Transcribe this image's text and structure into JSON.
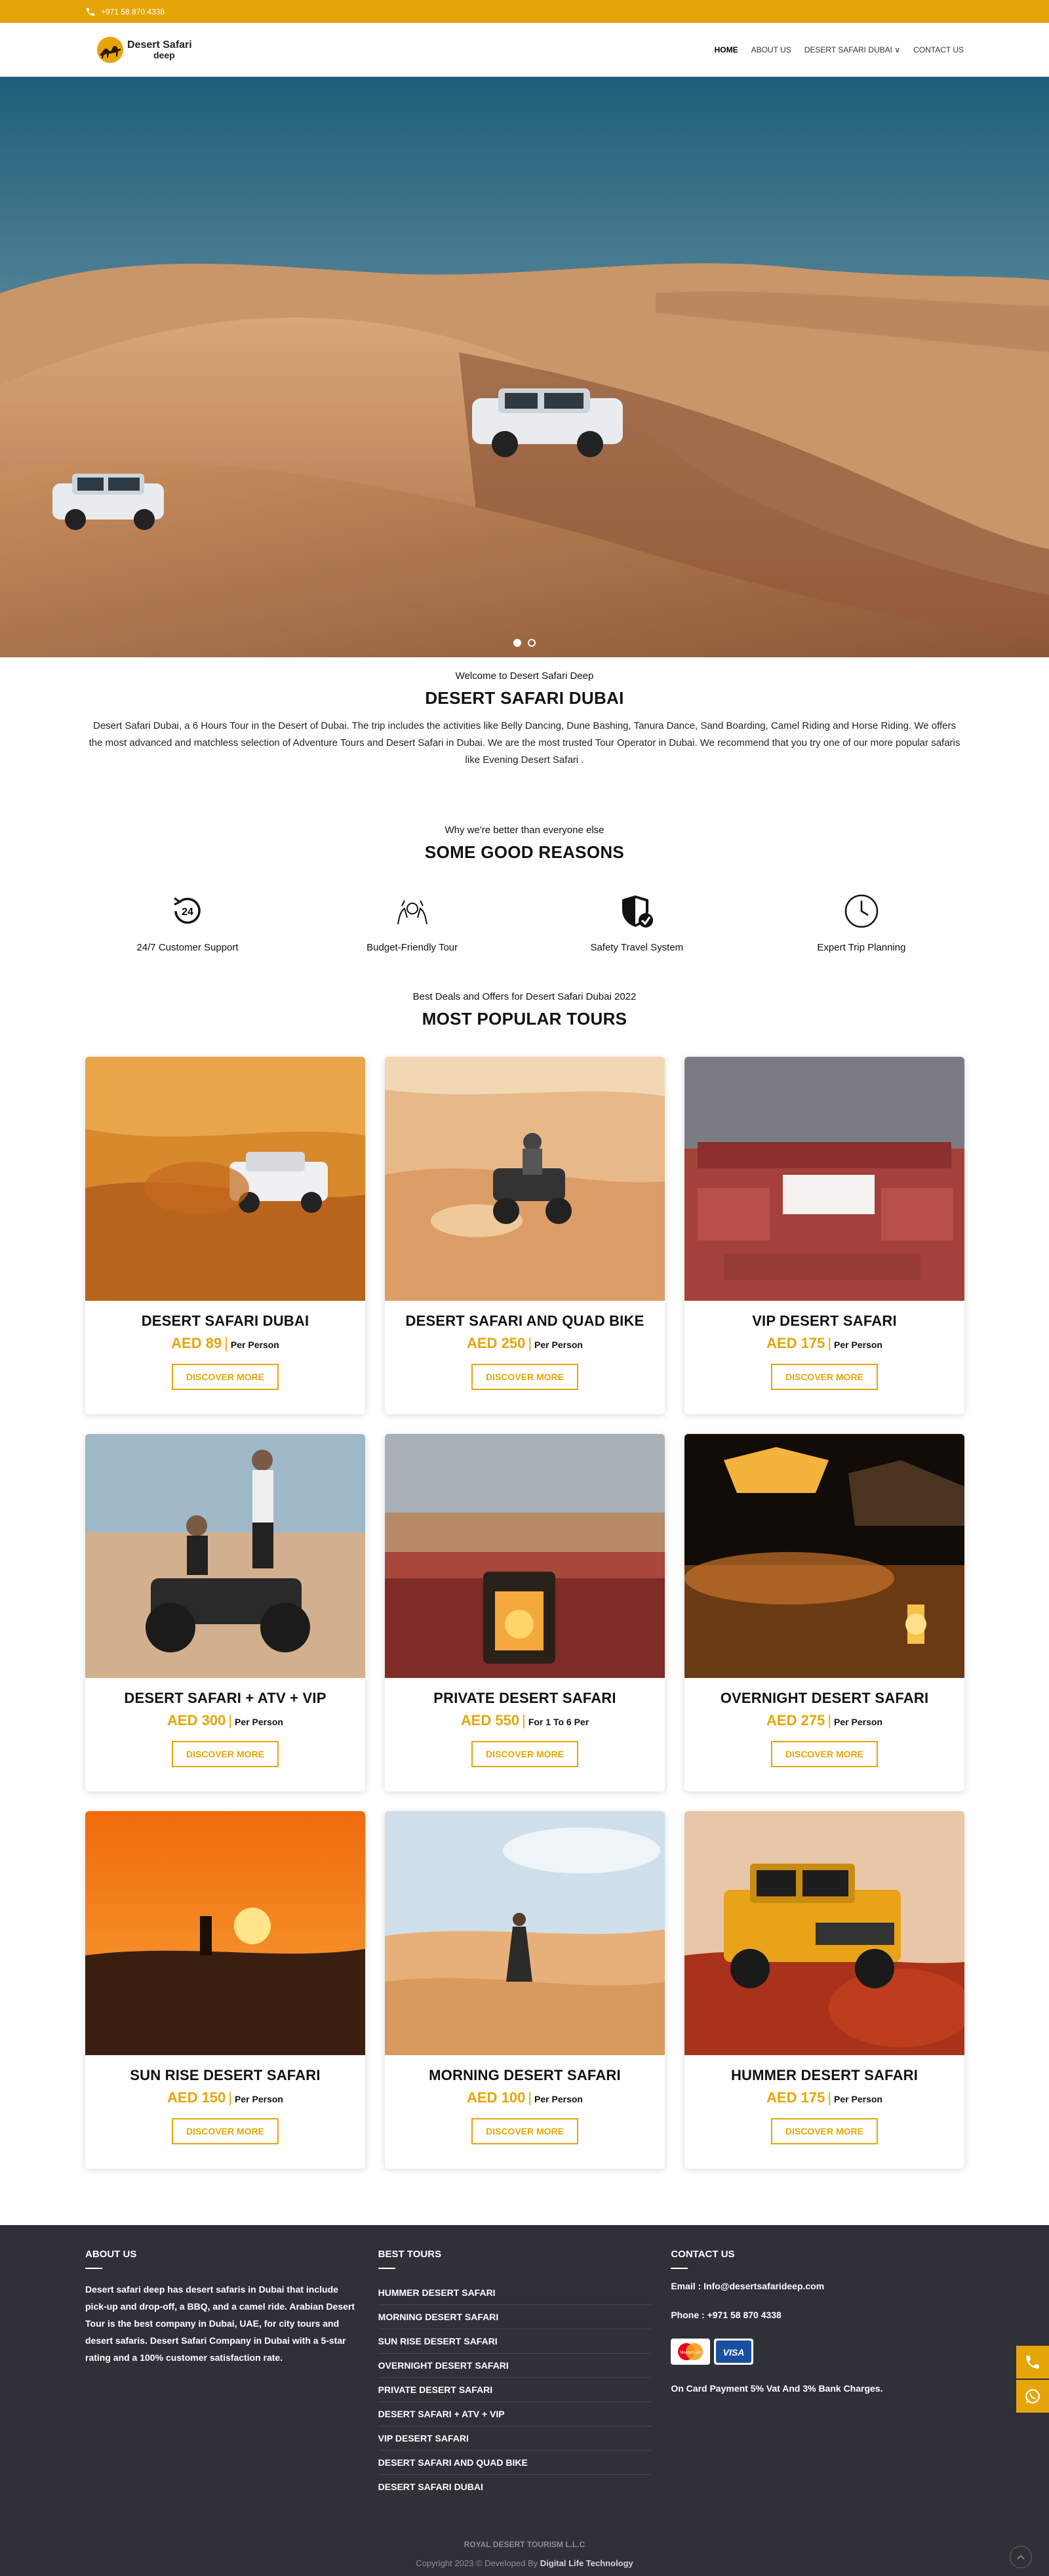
{
  "topbar": {
    "phone": "+971 58 870 4338",
    "icon": "phone-icon"
  },
  "header": {
    "logo_line1": "Desert Safari",
    "logo_line2": "deep",
    "nav": [
      {
        "label": "HOME",
        "active": true
      },
      {
        "label": "ABOUT US",
        "active": false
      },
      {
        "label": "DESERT SAFARI DUBAI ∨",
        "active": false
      },
      {
        "label": "CONTACT US",
        "active": false
      }
    ]
  },
  "hero": {
    "slides": 2,
    "active_slide": 1
  },
  "welcome": {
    "eyebrow": "Welcome to Desert Safari Deep",
    "title": "DESERT SAFARI DUBAI",
    "text": "Desert Safari Dubai, a 6 Hours Tour in the Desert of Dubai. The trip includes the activities like Belly Dancing, Dune Bashing, Tanura Dance, Sand Boarding, Camel Riding and Horse Riding. We offers the most advanced and matchless selection of Adventure Tours and Desert Safari in Dubai. We are the most trusted Tour Operator in Dubai. We recommend that you try one of our more popular safaris like Evening Desert Safari ."
  },
  "reasons": {
    "eyebrow": "Why we're better than everyone else",
    "title": "SOME GOOD REASONS",
    "items": [
      {
        "label": "24/7 Customer Support",
        "icon": "support-24-icon",
        "icon_text": "24"
      },
      {
        "label": "Budget-Friendly Tour",
        "icon": "budget-hands-icon"
      },
      {
        "label": "Safety Travel System",
        "icon": "shield-check-icon"
      },
      {
        "label": "Expert Trip Planning",
        "icon": "clock-icon"
      }
    ]
  },
  "tours": {
    "eyebrow": "Best Deals and Offers for Desert Safari Dubai 2022",
    "title": "MOST POPULAR TOURS",
    "button_label": "DISCOVER MORE",
    "items": [
      {
        "name": "DESERT SAFARI DUBAI",
        "price": "AED 89",
        "per": "Per Person",
        "image": "desert-suv-image"
      },
      {
        "name": "DESERT SAFARI AND QUAD BIKE",
        "price": "AED 250",
        "per": "Per Person",
        "image": "quad-bike-image"
      },
      {
        "name": "VIP DESERT SAFARI",
        "price": "AED 175",
        "per": "Per Person",
        "image": "vip-camp-image"
      },
      {
        "name": "DESERT SAFARI + ATV + VIP",
        "price": "AED 300",
        "per": "Per Person",
        "image": "atv-couple-image"
      },
      {
        "name": "PRIVATE DESERT SAFARI",
        "price": "AED 550",
        "per": "For 1 To 6 Per",
        "image": "lantern-camp-image"
      },
      {
        "name": "OVERNIGHT DESERT SAFARI",
        "price": "AED 275",
        "per": "Per Person",
        "image": "night-camp-image"
      },
      {
        "name": "SUN RISE DESERT SAFARI",
        "price": "AED 150",
        "per": "Per Person",
        "image": "sunrise-image"
      },
      {
        "name": "MORNING DESERT SAFARI",
        "price": "AED 100",
        "per": "Per Person",
        "image": "morning-walk-image"
      },
      {
        "name": "HUMMER DESERT SAFARI",
        "price": "AED 175",
        "per": "Per Person",
        "image": "hummer-image"
      }
    ]
  },
  "footer": {
    "about": {
      "title": "ABOUT US",
      "text": "Desert safari deep has desert safaris in Dubai that include pick-up and drop-off, a BBQ, and a camel ride. Arabian Desert Tour is the best company in Dubai, UAE, for city tours and desert safaris. Desert Safari Company in Dubai with a 5-star rating and a 100% customer satisfaction rate."
    },
    "best_tours": {
      "title": "BEST TOURS",
      "items": [
        "HUMMER DESERT SAFARI",
        "MORNING DESERT SAFARI",
        "SUN RISE DESERT SAFARI",
        "OVERNIGHT DESERT SAFARI",
        "PRIVATE DESERT SAFARI",
        "DESERT SAFARI + ATV + VIP",
        "VIP DESERT SAFARI",
        "DESERT SAFARI AND QUAD BIKE",
        "DESERT SAFARI DUBAI"
      ]
    },
    "contact": {
      "title": "CONTACT US",
      "email": "Email : Info@desertsafarideep.com",
      "phone": "Phone : +971 58 870 4338",
      "card_note": "On Card Payment 5% Vat And 3% Bank Charges.",
      "card_mastercard": "MasterCard",
      "card_visa": "VISA"
    },
    "company": "ROYAL DESERT TOURISM L.L.C",
    "copyright": "Copyright 2023 © Developed By",
    "developer": "Digital Life Technology"
  },
  "colors": {
    "accent": "#e5a508",
    "footer_bg": "#303039"
  }
}
